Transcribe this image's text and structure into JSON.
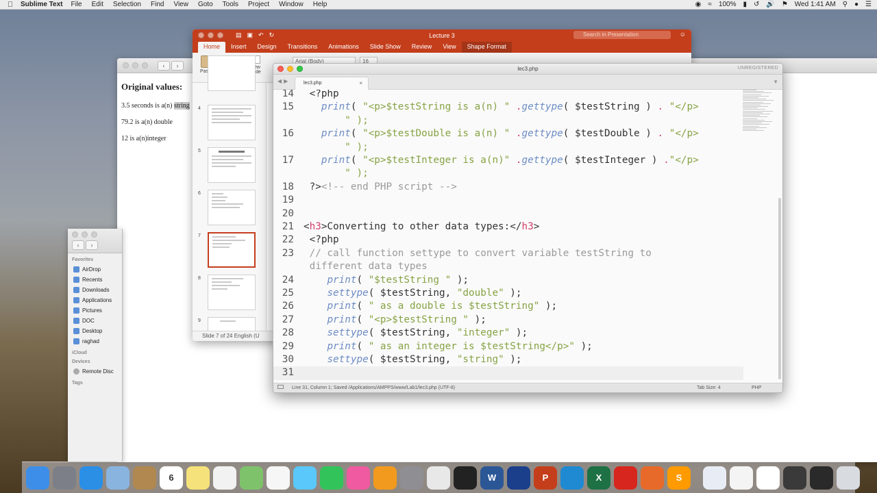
{
  "menubar": {
    "app_name": "Sublime Text",
    "items": [
      "File",
      "Edit",
      "Selection",
      "Find",
      "View",
      "Goto",
      "Tools",
      "Project",
      "Window",
      "Help"
    ],
    "battery": "100%",
    "clock": "Wed 1:41 AM"
  },
  "browser": {
    "heading": "Original values:",
    "line1_prefix": "3.5 seconds is a(n) ",
    "line1_highlight": "string",
    "line2": "79.2 is a(n) double",
    "line3": "12 is a(n)integer"
  },
  "finder": {
    "favorites_label": "Favorites",
    "favorites": [
      "AirDrop",
      "Recents",
      "Downloads",
      "Applications",
      "Pictures",
      "DOC",
      "Desktop",
      "raghad"
    ],
    "icloud_label": "iCloud",
    "devices_label": "Devices",
    "devices": [
      "Remote Disc"
    ],
    "tags_label": "Tags"
  },
  "ppt": {
    "title": "Lecture 3",
    "search_placeholder": "Search in Presentation",
    "tabs": [
      "Home",
      "Insert",
      "Design",
      "Transitions",
      "Animations",
      "Slide Show",
      "Review",
      "View",
      "Shape Format"
    ],
    "paste_label": "Paste",
    "new_slide_label": "New Slide",
    "font_name": "Arial (Body)",
    "font_size": "16",
    "slide_numbers": [
      "4",
      "5",
      "6",
      "7",
      "8",
      "9"
    ],
    "selected_slide": "7",
    "status": "Slide 7 of 24    English (U"
  },
  "sublime": {
    "window_title": "lec3.php",
    "unregistered": "UNREGISTERED",
    "tab_name": "lec3.php",
    "status_left": "Line 31, Column 1; Saved /Applications/AMPPS/www/Lab1/lec3.php (UTF-8)",
    "tab_size": "Tab Size: 4",
    "syntax": "PHP",
    "lines": [
      {
        "n": "14",
        "tokens": [
          {
            "t": " <?php",
            "c": "pun"
          }
        ]
      },
      {
        "n": "15",
        "tokens": [
          {
            "t": "   ",
            "c": "pun"
          },
          {
            "t": "print",
            "c": "fn"
          },
          {
            "t": "( ",
            "c": "pun"
          },
          {
            "t": "\"<p>$testString is a(n) \"",
            "c": "str"
          },
          {
            "t": " .",
            "c": "op"
          },
          {
            "t": "gettype",
            "c": "fn"
          },
          {
            "t": "( ",
            "c": "pun"
          },
          {
            "t": "$testString",
            "c": "var"
          },
          {
            "t": " ) ",
            "c": "pun"
          },
          {
            "t": ".",
            "c": "op"
          },
          {
            "t": " \"</p>",
            "c": "str"
          }
        ]
      },
      {
        "n": "",
        "tokens": [
          {
            "t": "       \" );",
            "c": "str"
          }
        ]
      },
      {
        "n": "16",
        "tokens": [
          {
            "t": "   ",
            "c": "pun"
          },
          {
            "t": "print",
            "c": "fn"
          },
          {
            "t": "( ",
            "c": "pun"
          },
          {
            "t": "\"<p>$testDouble is a(n) \"",
            "c": "str"
          },
          {
            "t": " .",
            "c": "op"
          },
          {
            "t": "gettype",
            "c": "fn"
          },
          {
            "t": "( ",
            "c": "pun"
          },
          {
            "t": "$testDouble",
            "c": "var"
          },
          {
            "t": " ) ",
            "c": "pun"
          },
          {
            "t": ".",
            "c": "op"
          },
          {
            "t": " \"</p>",
            "c": "str"
          }
        ]
      },
      {
        "n": "",
        "tokens": [
          {
            "t": "       \" );",
            "c": "str"
          }
        ]
      },
      {
        "n": "17",
        "tokens": [
          {
            "t": "   ",
            "c": "pun"
          },
          {
            "t": "print",
            "c": "fn"
          },
          {
            "t": "( ",
            "c": "pun"
          },
          {
            "t": "\"<p>$testInteger is a(n)\"",
            "c": "str"
          },
          {
            "t": " .",
            "c": "op"
          },
          {
            "t": "gettype",
            "c": "fn"
          },
          {
            "t": "( ",
            "c": "pun"
          },
          {
            "t": "$testInteger",
            "c": "var"
          },
          {
            "t": " ) ",
            "c": "pun"
          },
          {
            "t": ".",
            "c": "op"
          },
          {
            "t": "\"</p>",
            "c": "str"
          }
        ]
      },
      {
        "n": "",
        "tokens": [
          {
            "t": "       \" );",
            "c": "str"
          }
        ]
      },
      {
        "n": "18",
        "tokens": [
          {
            "t": " ?>",
            "c": "pun"
          },
          {
            "t": "<!-- end PHP script -->",
            "c": "com"
          }
        ]
      },
      {
        "n": "19",
        "tokens": []
      },
      {
        "n": "20",
        "tokens": []
      },
      {
        "n": "21",
        "tokens": [
          {
            "t": "<",
            "c": "pun"
          },
          {
            "t": "h3",
            "c": "tag"
          },
          {
            "t": ">Converting to other data types:</",
            "c": "pun"
          },
          {
            "t": "h3",
            "c": "tag"
          },
          {
            "t": ">",
            "c": "pun"
          }
        ]
      },
      {
        "n": "22",
        "tokens": [
          {
            "t": " <?php",
            "c": "pun"
          }
        ]
      },
      {
        "n": "23",
        "tokens": [
          {
            "t": " // call function settype to convert variable testString to",
            "c": "com"
          }
        ]
      },
      {
        "n": "",
        "tokens": [
          {
            "t": " different data types",
            "c": "com"
          }
        ]
      },
      {
        "n": "24",
        "tokens": [
          {
            "t": "    ",
            "c": "pun"
          },
          {
            "t": "print",
            "c": "fn"
          },
          {
            "t": "( ",
            "c": "pun"
          },
          {
            "t": "\"$testString \"",
            "c": "str"
          },
          {
            "t": " );",
            "c": "pun"
          }
        ]
      },
      {
        "n": "25",
        "tokens": [
          {
            "t": "    ",
            "c": "pun"
          },
          {
            "t": "settype",
            "c": "fn"
          },
          {
            "t": "( ",
            "c": "pun"
          },
          {
            "t": "$testString",
            "c": "var"
          },
          {
            "t": ", ",
            "c": "pun"
          },
          {
            "t": "\"double\"",
            "c": "str"
          },
          {
            "t": " );",
            "c": "pun"
          }
        ]
      },
      {
        "n": "26",
        "tokens": [
          {
            "t": "    ",
            "c": "pun"
          },
          {
            "t": "print",
            "c": "fn"
          },
          {
            "t": "( ",
            "c": "pun"
          },
          {
            "t": "\" as a double is $testString\"",
            "c": "str"
          },
          {
            "t": " );",
            "c": "pun"
          }
        ]
      },
      {
        "n": "27",
        "tokens": [
          {
            "t": "    ",
            "c": "pun"
          },
          {
            "t": "print",
            "c": "fn"
          },
          {
            "t": "( ",
            "c": "pun"
          },
          {
            "t": "\"<p>$testString \"",
            "c": "str"
          },
          {
            "t": " );",
            "c": "pun"
          }
        ]
      },
      {
        "n": "28",
        "tokens": [
          {
            "t": "    ",
            "c": "pun"
          },
          {
            "t": "settype",
            "c": "fn"
          },
          {
            "t": "( ",
            "c": "pun"
          },
          {
            "t": "$testString",
            "c": "var"
          },
          {
            "t": ", ",
            "c": "pun"
          },
          {
            "t": "\"integer\"",
            "c": "str"
          },
          {
            "t": " );",
            "c": "pun"
          }
        ]
      },
      {
        "n": "29",
        "tokens": [
          {
            "t": "    ",
            "c": "pun"
          },
          {
            "t": "print",
            "c": "fn"
          },
          {
            "t": "( ",
            "c": "pun"
          },
          {
            "t": "\" as an integer is $testString</p>\"",
            "c": "str"
          },
          {
            "t": " );",
            "c": "pun"
          }
        ]
      },
      {
        "n": "30",
        "tokens": [
          {
            "t": "    ",
            "c": "pun"
          },
          {
            "t": "settype",
            "c": "fn"
          },
          {
            "t": "( ",
            "c": "pun"
          },
          {
            "t": "$testString",
            "c": "var"
          },
          {
            "t": ", ",
            "c": "pun"
          },
          {
            "t": "\"string\"",
            "c": "str"
          },
          {
            "t": " );",
            "c": "pun"
          }
        ]
      },
      {
        "n": "31",
        "tokens": [],
        "current": true
      }
    ]
  },
  "dock": {
    "apps": [
      {
        "name": "finder",
        "color": "#3d8ee8",
        "label": ""
      },
      {
        "name": "launchpad",
        "color": "#7c7f88",
        "label": ""
      },
      {
        "name": "safari",
        "color": "#2b8fe6",
        "label": ""
      },
      {
        "name": "preview",
        "color": "#8ab4e0",
        "label": ""
      },
      {
        "name": "contacts",
        "color": "#b08850",
        "label": ""
      },
      {
        "name": "calendar",
        "color": "#ffffff",
        "label": "6"
      },
      {
        "name": "notes",
        "color": "#f6e27a",
        "label": ""
      },
      {
        "name": "reminders",
        "color": "#f2f2f2",
        "label": ""
      },
      {
        "name": "maps",
        "color": "#7ec36b",
        "label": ""
      },
      {
        "name": "photos",
        "color": "#f6f6f6",
        "label": ""
      },
      {
        "name": "messages",
        "color": "#5ac8fa",
        "label": ""
      },
      {
        "name": "facetime",
        "color": "#32c45a",
        "label": ""
      },
      {
        "name": "itunes",
        "color": "#f05aa0",
        "label": ""
      },
      {
        "name": "ibooks",
        "color": "#f29a1e",
        "label": ""
      },
      {
        "name": "system-preferences",
        "color": "#8e8e93",
        "label": ""
      },
      {
        "name": "chrome",
        "color": "#e8e8e8",
        "label": ""
      },
      {
        "name": "terminal",
        "color": "#222222",
        "label": ""
      },
      {
        "name": "word",
        "color": "#2b5797",
        "label": "W"
      },
      {
        "name": "quicktime",
        "color": "#1c3f8c",
        "label": ""
      },
      {
        "name": "powerpoint",
        "color": "#c43e1c",
        "label": "P"
      },
      {
        "name": "vscode",
        "color": "#1f8ad2",
        "label": ""
      },
      {
        "name": "excel",
        "color": "#1e7145",
        "label": "X"
      },
      {
        "name": "acrobat",
        "color": "#d6261d",
        "label": ""
      },
      {
        "name": "ampps",
        "color": "#e86a2a",
        "label": ""
      },
      {
        "name": "sublime-text",
        "color": "#ff9a00",
        "label": "S"
      }
    ],
    "right_items": [
      {
        "name": "png-file",
        "color": "#e8edf5"
      },
      {
        "name": "screenshot-file",
        "color": "#f4f4f4"
      },
      {
        "name": "document-file",
        "color": "#ffffff"
      },
      {
        "name": "window-thumb",
        "color": "#3a3a3a"
      },
      {
        "name": "node-file",
        "color": "#2a2a2a"
      },
      {
        "name": "trash",
        "color": "#d8dbe0"
      }
    ]
  }
}
